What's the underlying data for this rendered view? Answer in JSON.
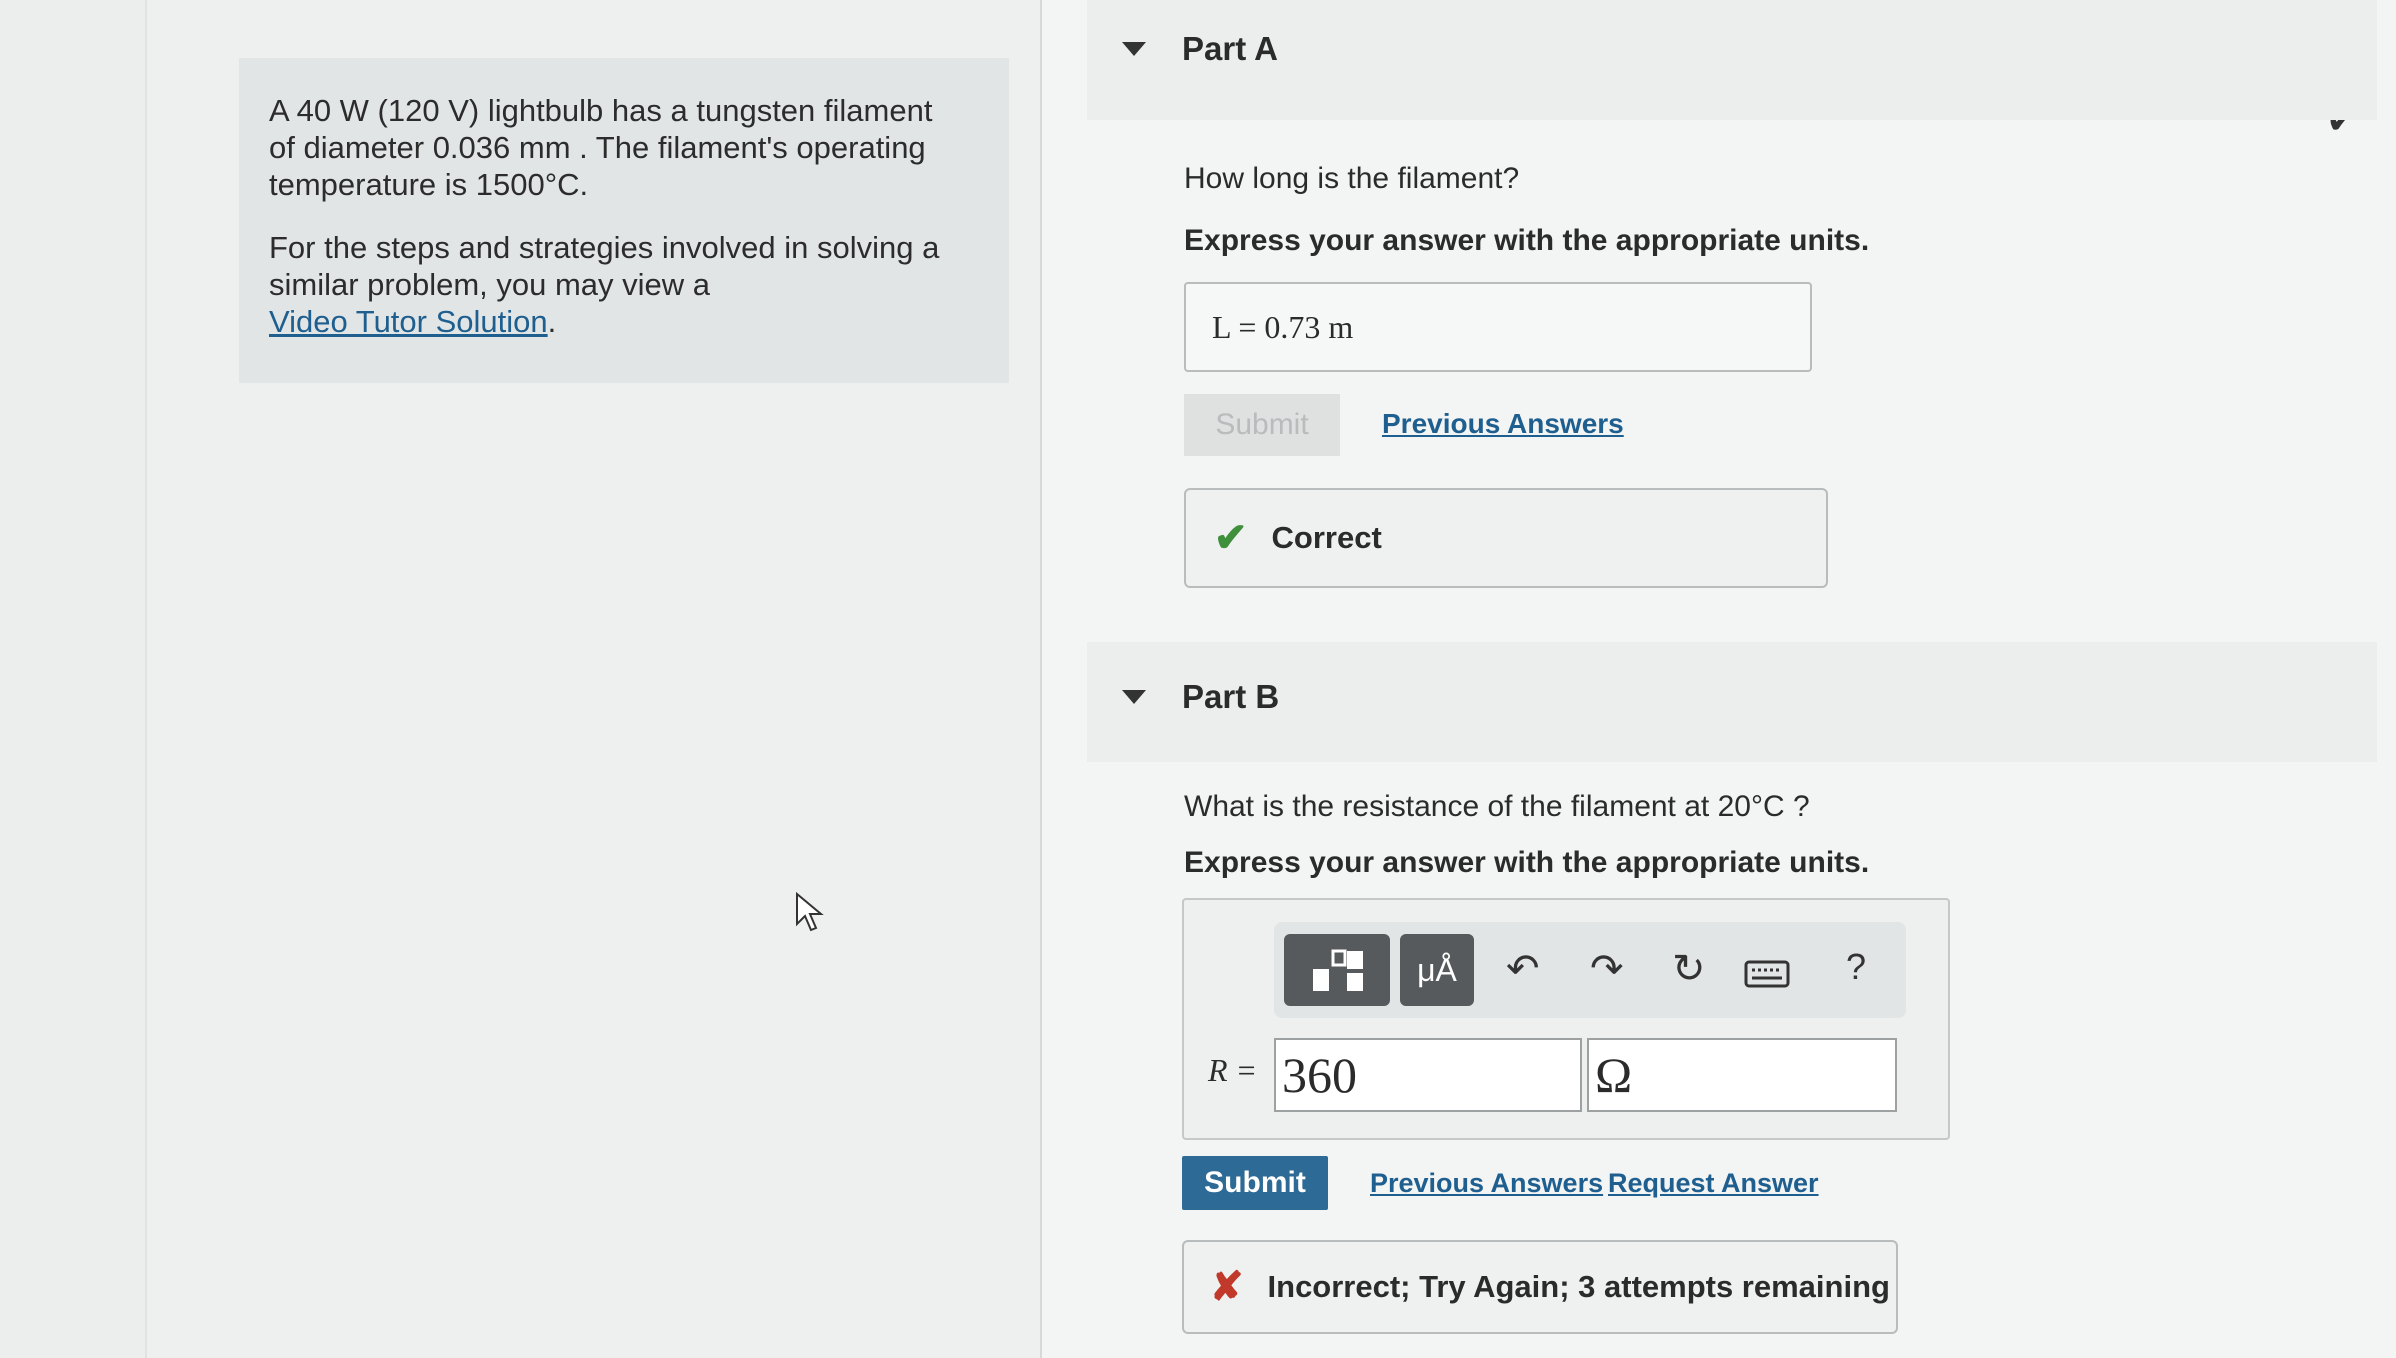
{
  "problem": {
    "line1": "A 40 W (120 V) lightbulb has a tungsten filament",
    "line2": "of diameter 0.036 mm . The filament's operating",
    "line3": "temperature is 1500°C.",
    "hint_line1": "For the steps and strategies involved in solving a",
    "hint_line2": "similar problem, you may view a",
    "video_link": "Video Tutor Solution",
    "video_link_suffix": "."
  },
  "part_a": {
    "title": "Part A",
    "question": "How long is the filament?",
    "instruction": "Express your answer with the appropriate units.",
    "answer": "L = 0.73 m",
    "submit_label": "Submit",
    "previous_answers": "Previous Answers",
    "feedback": "Correct"
  },
  "part_b": {
    "title": "Part B",
    "question": "What is the resistance of the filament at 20°C ?",
    "instruction": "Express your answer with the appropriate units.",
    "var_label": "R =",
    "value": "360",
    "unit": "Ω",
    "toolbar": {
      "templates_icon": "templates-icon",
      "units_icon": "units-icon",
      "units_text": "μÅ",
      "undo_icon": "undo-icon",
      "redo_icon": "redo-icon",
      "reset_icon": "reset-icon",
      "keyboard_icon": "keyboard-icon",
      "help": "?"
    },
    "submit_label": "Submit",
    "previous_answers": "Previous Answers",
    "request_answer": "Request Answer",
    "feedback": "Incorrect; Try Again; 3 attempts remaining"
  },
  "colors": {
    "submit_bg": "#2d6a95",
    "link": "#1f5f8f",
    "correct": "#3f8f3c",
    "incorrect": "#c0392b"
  }
}
